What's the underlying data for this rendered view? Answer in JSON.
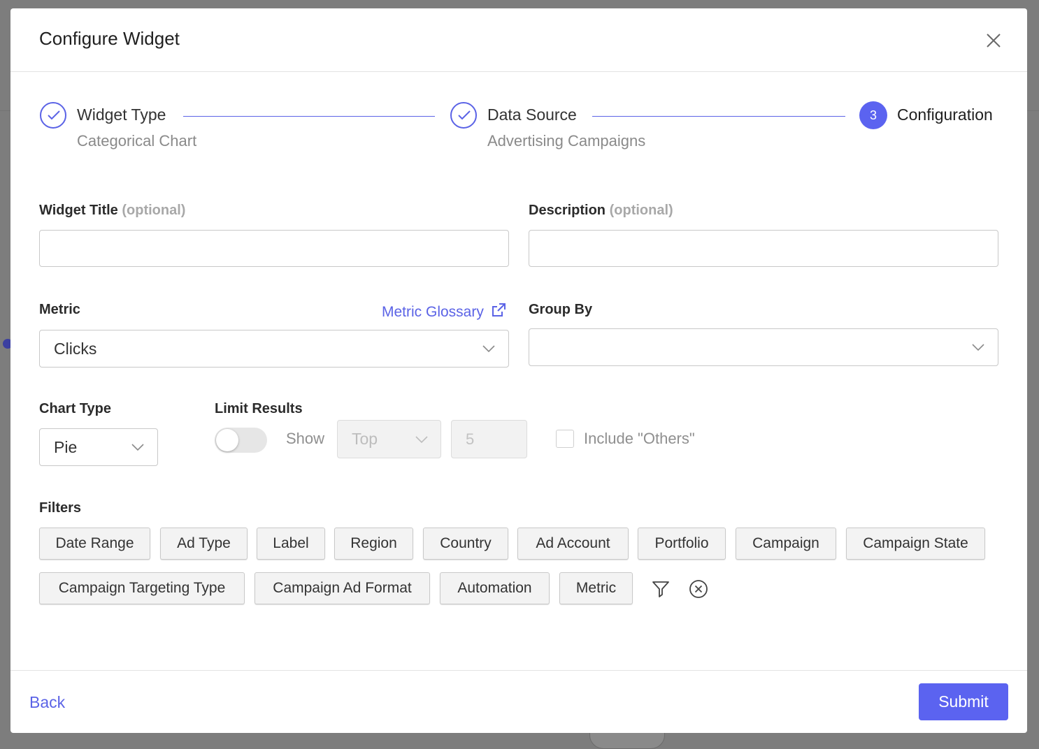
{
  "modal": {
    "title": "Configure Widget"
  },
  "stepper": {
    "steps": [
      {
        "label": "Widget Type",
        "sub": "Categorical Chart"
      },
      {
        "label": "Data Source",
        "sub": "Advertising Campaigns"
      },
      {
        "label": "Configuration",
        "number": "3"
      }
    ]
  },
  "form": {
    "widget_title_label": "Widget Title",
    "description_label": "Description",
    "optional_text": "(optional)",
    "widget_title_value": "",
    "description_value": "",
    "metric_label": "Metric",
    "metric_glossary_link": "Metric Glossary",
    "metric_value": "Clicks",
    "group_by_label": "Group By",
    "group_by_value": "",
    "chart_type_label": "Chart Type",
    "chart_type_value": "Pie",
    "limit_results_label": "Limit Results",
    "limit_enabled": false,
    "show_label": "Show",
    "limit_direction": "Top",
    "limit_count": "5",
    "include_others_label": "Include \"Others\"",
    "include_others_checked": false,
    "filters_label": "Filters",
    "filters": [
      "Date Range",
      "Ad Type",
      "Label",
      "Region",
      "Country",
      "Ad Account",
      "Portfolio",
      "Campaign",
      "Campaign State",
      "Campaign Targeting Type",
      "Campaign Ad Format",
      "Automation",
      "Metric"
    ]
  },
  "footer": {
    "back_label": "Back",
    "submit_label": "Submit"
  },
  "colors": {
    "accent": "#5b63f0",
    "overlay": "#7d7d7d"
  },
  "icons": [
    "close-icon",
    "check-icon",
    "chevron-down-icon",
    "external-link-icon",
    "funnel-icon",
    "clear-circle-icon"
  ]
}
